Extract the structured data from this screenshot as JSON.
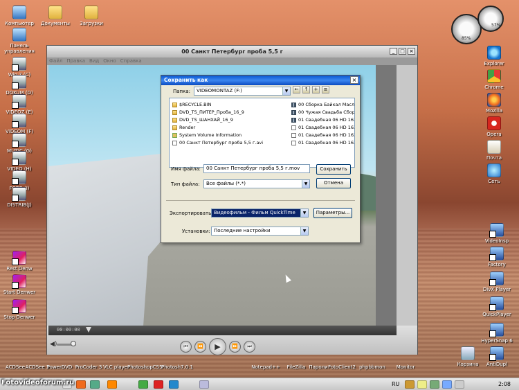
{
  "desktop": {
    "left_icons": [
      {
        "label": "Компьютер",
        "icon": "computer-icon"
      },
      {
        "label": "Панель управления",
        "icon": "control-panel-icon"
      },
      {
        "label": "Win 7 (C)",
        "icon": "drive-icon"
      },
      {
        "label": "DOKUM (D)",
        "icon": "drive-icon"
      },
      {
        "label": "VIDEOZ (E)",
        "icon": "drive-icon"
      },
      {
        "label": "VIDEOM (F)",
        "icon": "drive-icon"
      },
      {
        "label": "MUZIC (G)",
        "icon": "drive-icon"
      },
      {
        "label": "VIDEO (H)",
        "icon": "drive-icon"
      },
      {
        "label": "FOTO (I)",
        "icon": "drive-icon"
      },
      {
        "label": "DISTRIB(J)",
        "icon": "drive-icon"
      },
      {
        "label": "Rest Denw",
        "icon": "denwer-icon"
      },
      {
        "label": "Start Denwer",
        "icon": "denwer-icon"
      },
      {
        "label": "Stop Denwer",
        "icon": "denwer-icon"
      }
    ],
    "top_icons": [
      {
        "label": "Документы",
        "icon": "documents-icon"
      },
      {
        "label": "Загрузки",
        "icon": "downloads-icon"
      }
    ],
    "right_icons": [
      {
        "label": "Explorer",
        "icon": "ie-icon"
      },
      {
        "label": "Chrome",
        "icon": "chrome-icon"
      },
      {
        "label": "Mozilla",
        "icon": "firefox-icon"
      },
      {
        "label": "Opera",
        "icon": "opera-icon"
      },
      {
        "label": "Почта",
        "icon": "mail-icon"
      },
      {
        "label": "Сеть",
        "icon": "network-icon"
      },
      {
        "label": "VideoInsp",
        "icon": "app-icon"
      },
      {
        "label": "Factory",
        "icon": "app-icon"
      },
      {
        "label": "DivX Player",
        "icon": "app-icon"
      },
      {
        "label": "QuickPlayer",
        "icon": "app-icon"
      },
      {
        "label": "HyperSnap 6",
        "icon": "app-icon"
      },
      {
        "label": "Корзина",
        "icon": "recycle-bin-icon"
      },
      {
        "label": "AntiDupl",
        "icon": "app-icon"
      }
    ],
    "bottom_row": [
      "ACDSee",
      "ACDSee 3",
      "PowerDVD",
      "ProCoder 3",
      "VLC player",
      "PhotoshopCS5",
      "Photosh7.0.1",
      "Notepad++",
      "FileZilla",
      "Пароли",
      "FotoClient2",
      "phpbbmon",
      "Monitor"
    ],
    "gadget_values": {
      "cpu": "85%",
      "ram": "57%"
    }
  },
  "player": {
    "title": "00 Санкт Петербург проба 5,5 г",
    "menu": [
      "Файл",
      "Правка",
      "Вид",
      "Окно",
      "Справка"
    ],
    "timecode": "00:00:00",
    "progress": 0.0,
    "volume": 0.85,
    "controls": {
      "prev": "⏮",
      "rew": "⏪",
      "play": "▶",
      "ff": "⏩",
      "next": "⏭"
    }
  },
  "dialog": {
    "title": "Сохранить как",
    "folder_label": "Папка:",
    "folder_value": "VIDEOMONTAZ (F:)",
    "files_left": [
      {
        "name": "$RECYCLE.BIN",
        "type": "folder"
      },
      {
        "name": "DVD_TS_ПИТЕР_Проба_16_9",
        "type": "folder"
      },
      {
        "name": "DVD_TS_ШАНХАЙ_16_9",
        "type": "folder"
      },
      {
        "name": "Render",
        "type": "folder"
      },
      {
        "name": "System Volume Information",
        "type": "lock"
      },
      {
        "name": "00 Санкт Петербург проба 5,5 г.avi",
        "type": "file"
      }
    ],
    "files_right": [
      {
        "name": "00 Сборка Байкал Масло",
        "type": "film"
      },
      {
        "name": "00 Чужая Свадьба Сбор",
        "type": "film"
      },
      {
        "name": "01 Свадебная 06 HD 16X",
        "type": "film"
      },
      {
        "name": "01 Свадебная 06 HD 16X",
        "type": "file"
      },
      {
        "name": "01 Свадебная 06 HD 16X",
        "type": "file"
      },
      {
        "name": "01 Свадебная 06 HD 16X",
        "type": "file"
      }
    ],
    "filename_label": "Имя файла:",
    "filename_value": "00 Санкт Петербург проба 5,5 г.mov",
    "filetype_label": "Тип файла:",
    "filetype_value": "Все файлы (*.*)",
    "save_button": "Сохранить",
    "cancel_button": "Отмена",
    "export_label": "Экспортировать:",
    "export_value": "Видеофильм - Фильм QuickTime",
    "params_button": "Параметры...",
    "settings_label": "Установки:",
    "settings_value": "Последние настройки"
  },
  "taskbar": {
    "watermark": "Fotovideoforum.ru",
    "lang": "RU",
    "clock": "2:08"
  },
  "colors": {
    "title_blue": "#0a58d0",
    "selection": "#0a246a"
  }
}
